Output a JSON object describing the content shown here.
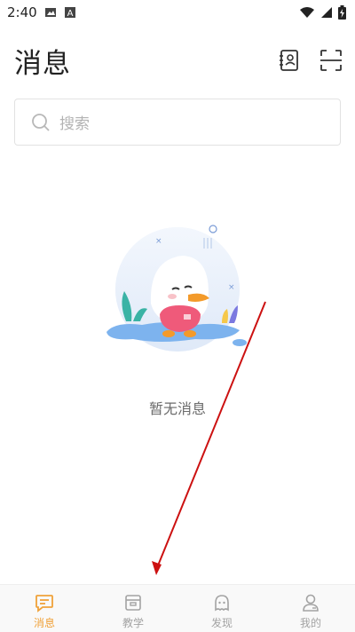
{
  "status_bar": {
    "time": "2:40"
  },
  "header": {
    "title": "消息"
  },
  "search": {
    "placeholder": "搜索"
  },
  "empty_state": {
    "text": "暂无消息"
  },
  "tabbar": {
    "active_index": 0,
    "items": [
      {
        "label": "消息",
        "icon": "message-icon"
      },
      {
        "label": "教学",
        "icon": "teaching-icon"
      },
      {
        "label": "发现",
        "icon": "discover-icon"
      },
      {
        "label": "我的",
        "icon": "profile-icon"
      }
    ]
  },
  "colors": {
    "accent": "#f0a23a",
    "inactive": "#a3a3a3",
    "annotation": "#cc1111"
  }
}
